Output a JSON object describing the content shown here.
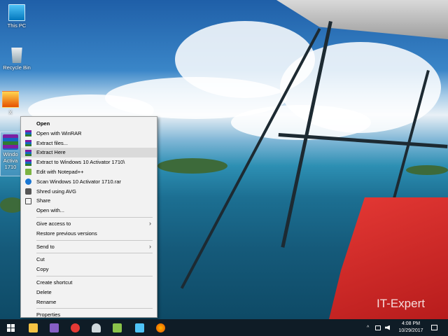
{
  "desktop": {
    "icons": [
      {
        "label": "This PC",
        "icon": "computer-icon"
      },
      {
        "label": "Recycle Bin",
        "icon": "recycle-bin-icon"
      },
      {
        "label": "X",
        "icon": "file-icon"
      },
      {
        "label": "Windo Activa 1710",
        "icon": "winrar-archive-icon"
      }
    ],
    "watermark": "IT-Expert"
  },
  "context_menu": {
    "items": [
      {
        "label": "Open",
        "bold": true
      },
      {
        "label": "Open with WinRAR",
        "icon": "winrar-icon"
      },
      {
        "label": "Extract files...",
        "icon": "winrar-icon"
      },
      {
        "label": "Extract Here",
        "icon": "winrar-icon",
        "highlighted": true
      },
      {
        "label": "Extract to Windows 10 Activator 1710\\",
        "icon": "winrar-icon"
      },
      {
        "label": "Edit with Notepad++",
        "icon": "notepad-plus-plus-icon"
      },
      {
        "label": "Scan Windows 10 Activator 1710.rar",
        "icon": "avg-icon"
      },
      {
        "label": "Shred using AVG",
        "icon": "shredder-icon"
      },
      {
        "label": "Share",
        "icon": "share-icon"
      },
      {
        "label": "Open with..."
      },
      {
        "label": "Give access to",
        "submenu": true
      },
      {
        "label": "Restore previous versions"
      },
      {
        "label": "Send to",
        "submenu": true
      },
      {
        "label": "Cut"
      },
      {
        "label": "Copy"
      },
      {
        "label": "Create shortcut"
      },
      {
        "label": "Delete"
      },
      {
        "label": "Rename"
      },
      {
        "label": "Properties"
      }
    ]
  },
  "taskbar": {
    "apps": [
      "start-icon",
      "file-explorer-icon",
      "visual-studio-icon",
      "devexpress-icon",
      "user-icon",
      "notepad-plus-plus-icon",
      "remote-desktop-icon",
      "firefox-icon"
    ],
    "tray": {
      "chevron": "^"
    },
    "clock": {
      "time": "4:08 PM",
      "date": "10/29/2017"
    },
    "colors": {
      "taskbar": "#0f1c26",
      "menu_highlight": "#dadada"
    }
  }
}
